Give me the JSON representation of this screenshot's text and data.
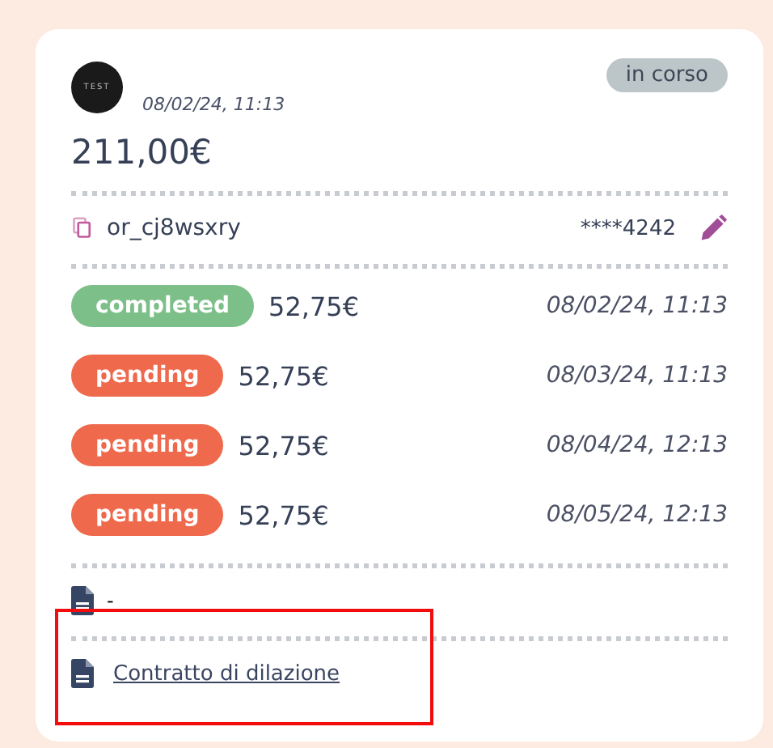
{
  "header": {
    "logo_text": "TEST",
    "date": "08/02/24, 11:13",
    "status": "in corso",
    "total": "211,00€"
  },
  "order": {
    "id": "or_cj8wsxry",
    "card": "****4242"
  },
  "installments": [
    {
      "status": "completed",
      "kind": "completed",
      "amount": "52,75€",
      "date": "08/02/24, 11:13"
    },
    {
      "status": "pending",
      "kind": "pending",
      "amount": "52,75€",
      "date": "08/03/24, 11:13"
    },
    {
      "status": "pending",
      "kind": "pending",
      "amount": "52,75€",
      "date": "08/04/24, 12:13"
    },
    {
      "status": "pending",
      "kind": "pending",
      "amount": "52,75€",
      "date": "08/05/24, 12:13"
    }
  ],
  "documents": [
    {
      "label": "-",
      "link": false,
      "highlighted": false
    },
    {
      "label": "Contratto di dilazione",
      "link": true,
      "highlighted": true
    }
  ]
}
